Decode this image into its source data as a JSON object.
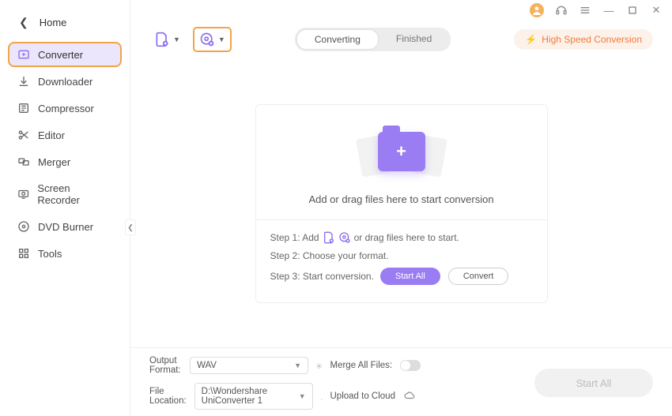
{
  "window": {
    "home_label": "Home"
  },
  "sidebar": {
    "items": [
      {
        "label": "Converter"
      },
      {
        "label": "Downloader"
      },
      {
        "label": "Compressor"
      },
      {
        "label": "Editor"
      },
      {
        "label": "Merger"
      },
      {
        "label": "Screen Recorder"
      },
      {
        "label": "DVD Burner"
      },
      {
        "label": "Tools"
      }
    ]
  },
  "toolbar": {
    "tabs": {
      "converting": "Converting",
      "finished": "Finished"
    },
    "high_speed": "High Speed Conversion"
  },
  "dropzone": {
    "title": "Add or drag files here to start conversion",
    "step1_pre": "Step 1: Add",
    "step1_post": "or drag files here to start.",
    "step2": "Step 2: Choose your format.",
    "step3": "Step 3: Start conversion.",
    "start_all": "Start All",
    "convert": "Convert"
  },
  "bottom": {
    "output_format_label": "Output Format:",
    "output_format_value": "WAV",
    "merge_label": "Merge All Files:",
    "file_location_label": "File Location:",
    "file_location_value": "D:\\Wondershare UniConverter 1",
    "upload_label": "Upload to Cloud",
    "start_all": "Start All"
  }
}
